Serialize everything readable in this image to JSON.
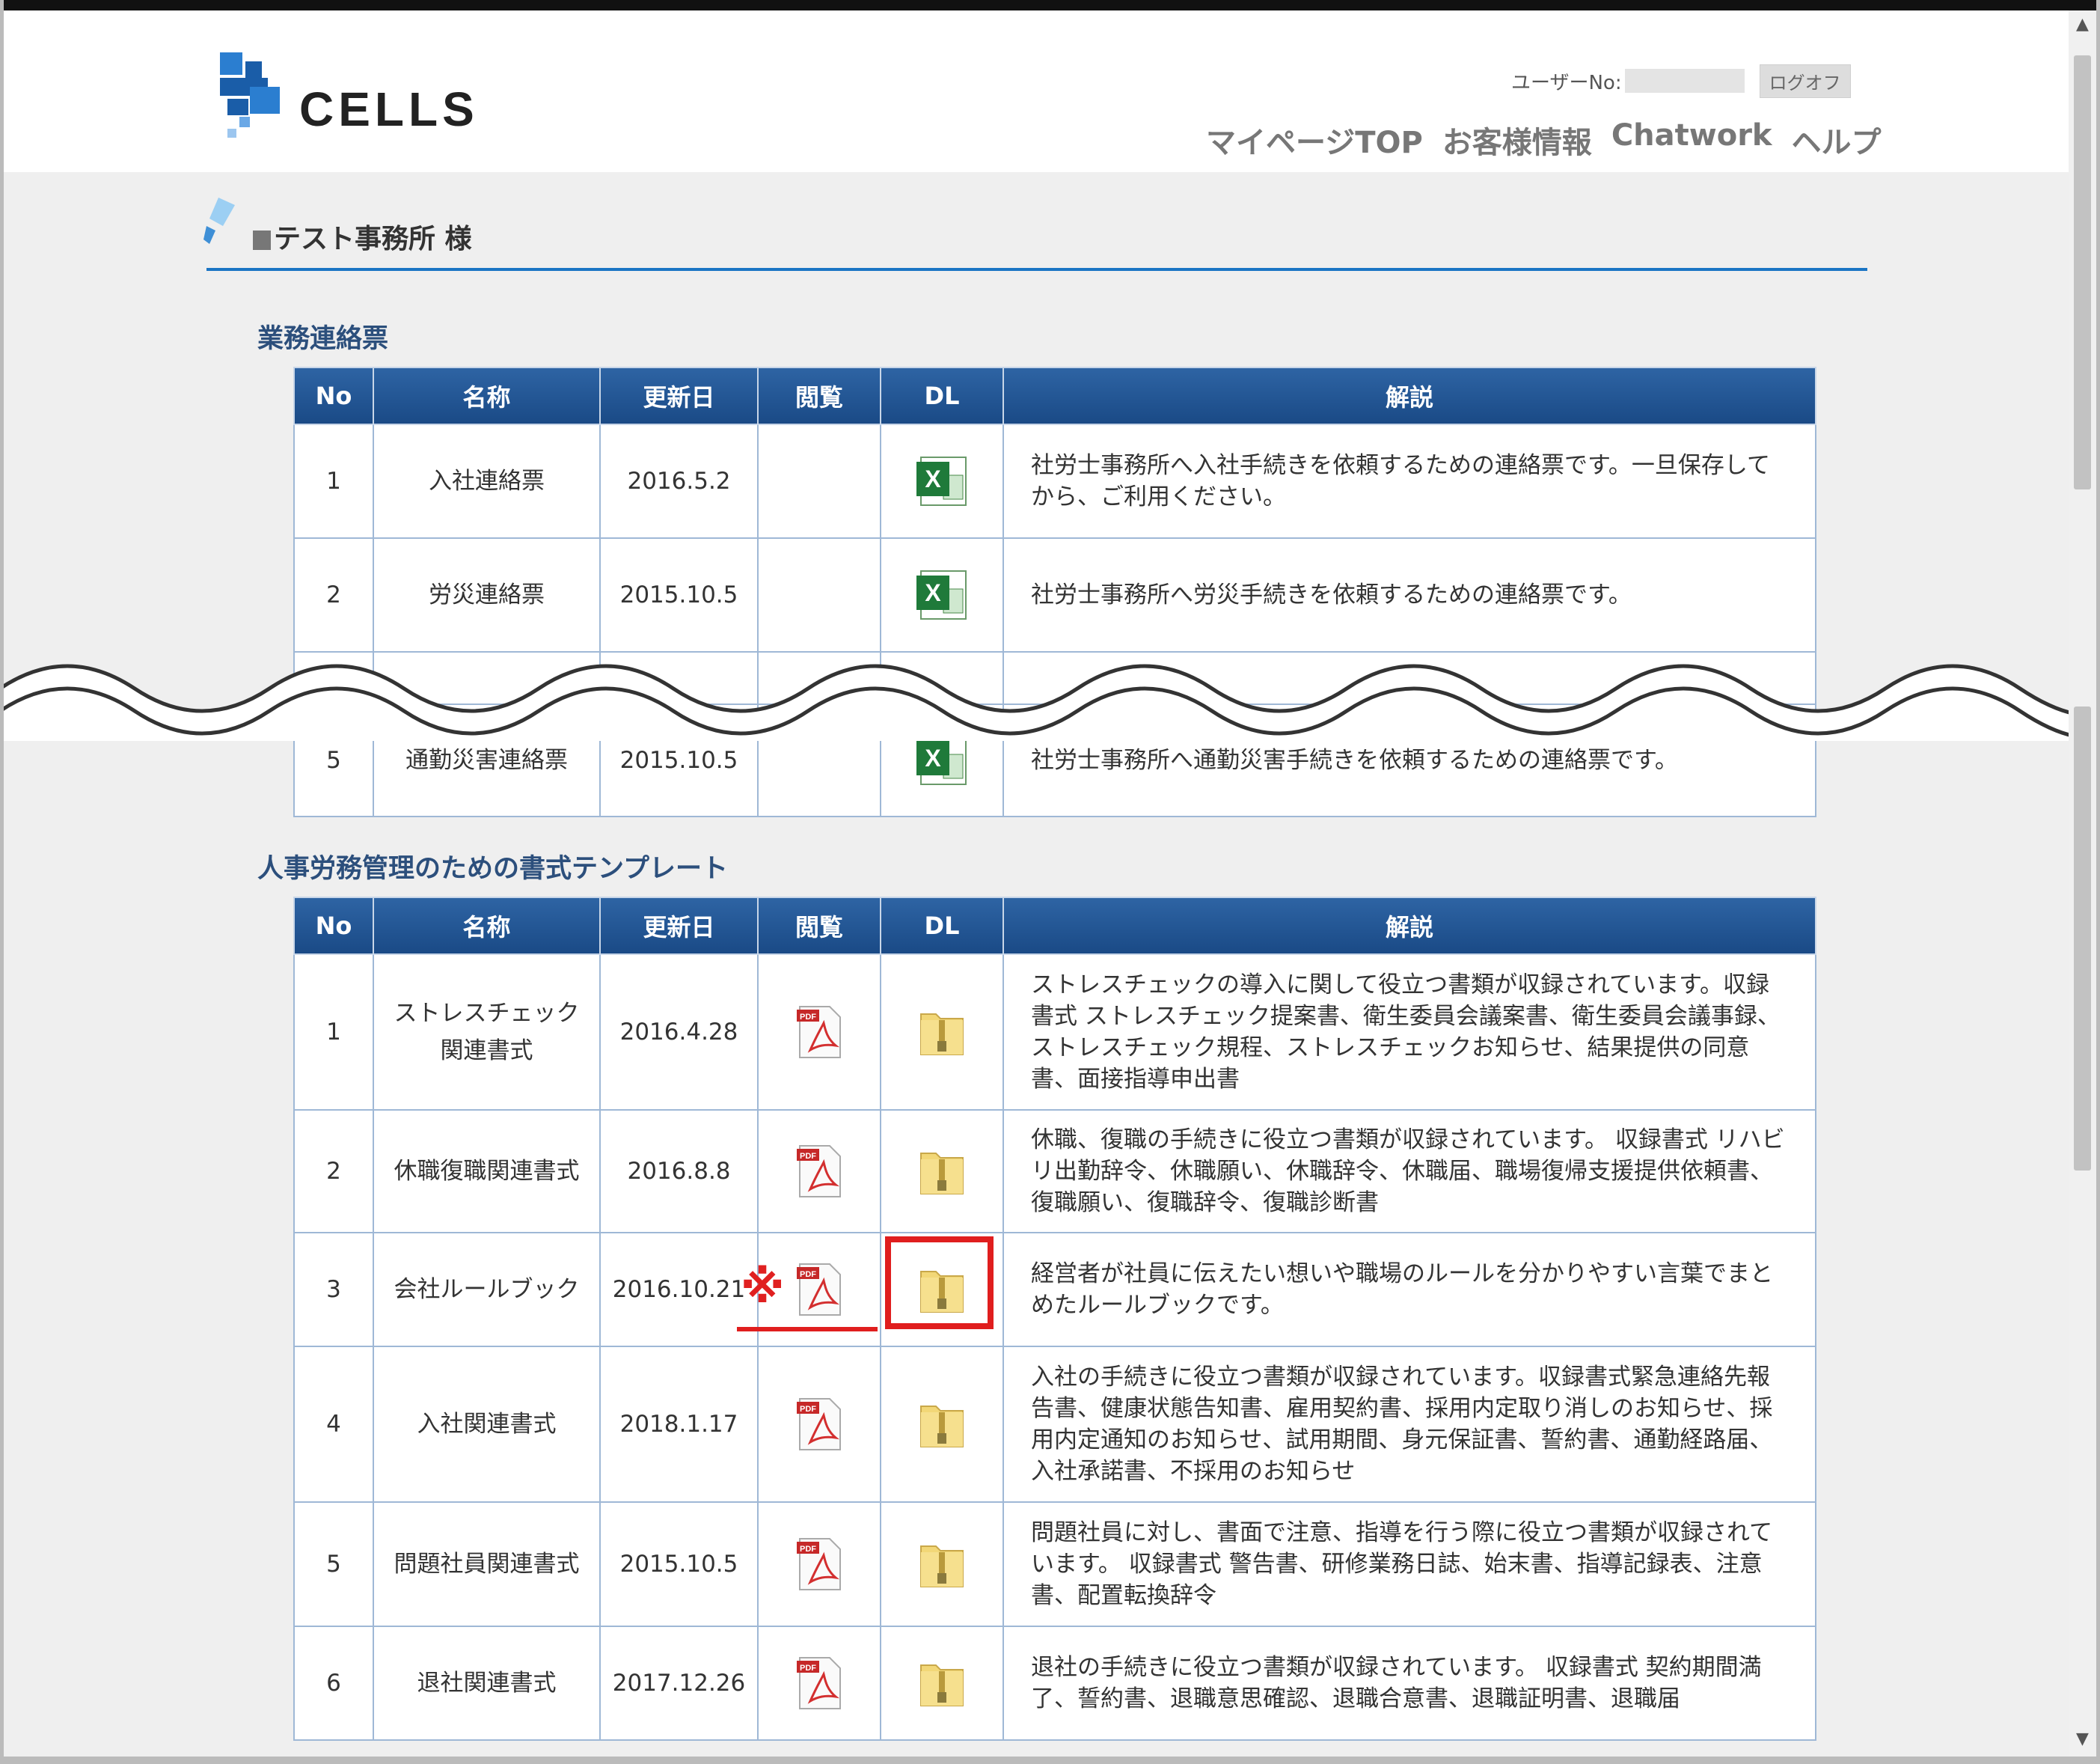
{
  "header": {
    "brand": "CELLS",
    "user_label": "ユーザーNo:",
    "logout_label": "ログオフ",
    "nav": [
      "マイページTOP",
      "お客様情報",
      "Chatwork",
      "ヘルプ"
    ]
  },
  "page": {
    "title": "テスト事務所 様"
  },
  "columns": [
    "No",
    "名称",
    "更新日",
    "閲覧",
    "DL",
    "解説"
  ],
  "sections": [
    {
      "title": "業務連絡票",
      "rows": [
        {
          "no": "1",
          "name": "入社連絡票",
          "date": "2016.5.2",
          "desc": "社労士事務所へ入社手続きを依頼するための連絡票です。一旦保存してから、ご利用ください。"
        },
        {
          "no": "2",
          "name": "労災連絡票",
          "date": "2015.10.5",
          "desc": "社労士事務所へ労災手続きを依頼するための連絡票です。"
        },
        {
          "no": "5",
          "name": "通勤災害連絡票",
          "date": "2015.10.5",
          "desc": "社労士事務所へ通勤災害手続きを依頼するための連絡票です。"
        }
      ]
    },
    {
      "title": "人事労務管理のための書式テンプレート",
      "rows": [
        {
          "no": "1",
          "name": "ストレスチェック関連書式",
          "date": "2016.4.28",
          "desc": "ストレスチェックの導入に関して役立つ書類が収録されています。収録書式 ストレスチェック提案書、衛生委員会議案書、衛生委員会議事録、ストレスチェック規程、ストレスチェックお知らせ、結果提供の同意書、面接指導申出書"
        },
        {
          "no": "2",
          "name": "休職復職関連書式",
          "date": "2016.8.8",
          "desc": "休職、復職の手続きに役立つ書類が収録されています。 収録書式 リハビリ出勤辞令、休職願い、休職辞令、休職届、職場復帰支援提供依頼書、復職願い、復職辞令、復職診断書"
        },
        {
          "no": "3",
          "name": "会社ルールブック",
          "date": "2016.10.21",
          "desc": "経営者が社員に伝えたい想いや職場のルールを分かりやすい言葉でまとめたルールブックです。"
        },
        {
          "no": "4",
          "name": "入社関連書式",
          "date": "2018.1.17",
          "desc": "入社の手続きに役立つ書類が収録されています。収録書式緊急連絡先報告書、健康状態告知書、雇用契約書、採用内定取り消しのお知らせ、採用内定通知のお知らせ、試用期間、身元保証書、誓約書、通勤経路届、入社承諾書、不採用のお知らせ"
        },
        {
          "no": "5",
          "name": "問題社員関連書式",
          "date": "2015.10.5",
          "desc": "問題社員に対し、書面で注意、指導を行う際に役立つ書類が収録されています。 収録書式 警告書、研修業務日誌、始末書、指導記録表、注意書、配置転換辞令"
        },
        {
          "no": "6",
          "name": "退社関連書式",
          "date": "2017.12.26",
          "desc": "退社の手続きに役立つ書類が収録されています。 収録書式 契約期間満了、誓約書、退職意思確認、退職合意書、退職証明書、退職届"
        }
      ]
    }
  ],
  "annotations": {
    "asterisk": "※"
  },
  "icons": {
    "excel": "excel-file-icon",
    "pdf": "pdf-file-icon",
    "zip": "zip-folder-icon"
  },
  "colors": {
    "header_blue": "#1a4a86",
    "title_line": "#1b75c4",
    "section_title": "#2c4f7c",
    "highlight_red": "#e01e1e"
  }
}
